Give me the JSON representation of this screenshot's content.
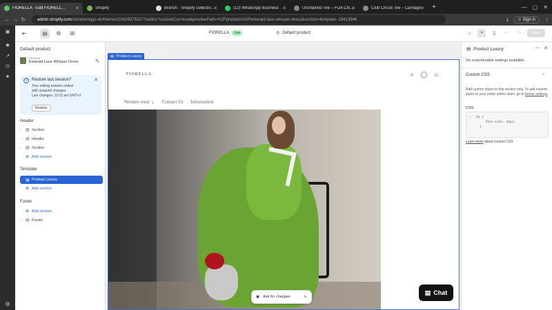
{
  "browser": {
    "tabs": [
      {
        "title": "FIORELLA · Edit FIORELLA · Sh",
        "color": "#5ac76a",
        "active": true
      },
      {
        "title": "Shopify",
        "color": "#7ab55c",
        "active": false
      },
      {
        "title": "Branch · Shopify collection dis",
        "color": "#dddddd",
        "active": false
      },
      {
        "title": "(12) WhatsApp Business",
        "color": "#25d366",
        "active": false
      },
      {
        "title": "Unchained Tee – FOA Clothing",
        "color": "#888888",
        "active": false
      },
      {
        "title": "Club Circuit Tee – Carnage",
        "color": "#888888",
        "active": false
      }
    ],
    "url_host": "admin.shopify.com",
    "url_path": "/store/txmqgs-dn/themes/184293753177/editor?customCss=true&previewPath=%2Fproducts%2Femerald-lace-whisper-dress&section=template--29413946",
    "signin_label": "Sign in"
  },
  "editor": {
    "theme_name": "FIORELLA",
    "live_badge": "Live",
    "template_name": "Default product",
    "save_label": "Save"
  },
  "sidebar": {
    "title": "Default product",
    "preview_label": "Preview",
    "preview_value": "Emerald Lace Whisper Dress",
    "restore": {
      "title": "Restore last session?",
      "body_line1": "Your editing session ended",
      "body_line2": "with unsaved changes",
      "last_changes": "Last changes: 12:52 am GMT+2",
      "button": "Restore"
    },
    "header_group": "Header",
    "header_items": [
      "Section",
      "Header",
      "Section"
    ],
    "add_section": "Add section",
    "template_group": "Template",
    "template_active": "Product Luxury",
    "footer_group": "Footer",
    "footer_item": "Footer"
  },
  "canvas": {
    "section_tag": "Product Luxury",
    "store_logo": "FIORELLA",
    "nav": [
      "Women wear ⌄",
      "Contact Us",
      "Information"
    ],
    "ask_label": "Ask for changes",
    "chat_label": "Chat"
  },
  "rpanel": {
    "title": "Product Luxury",
    "no_settings": "No customizable settings available.",
    "custom_css": "Custom CSS",
    "desc_1": "Add custom styles to this section only. To add custom styles to your entire online store, go to",
    "desc_link": "theme settings",
    "css_label": "CSS",
    "code_1": "h2 {",
    "code_2": "font-size: 32px;",
    "code_3": "}",
    "learn_link": "Learn more",
    "learn_rest": "about custom CSS"
  },
  "colors": {
    "accent": "#2a63d4",
    "live_badge": "#a7f0ba",
    "dress": "#6aa534"
  }
}
